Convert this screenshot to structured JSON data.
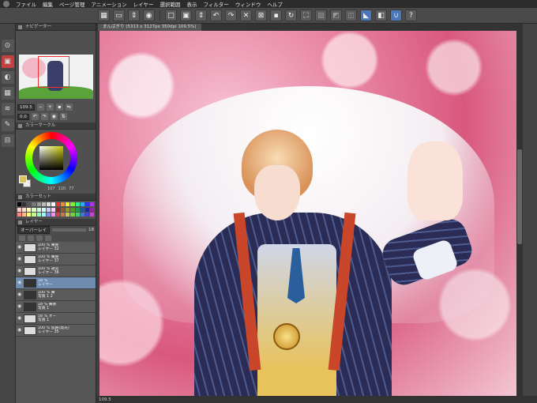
{
  "menu": [
    "ファイル",
    "編集",
    "ページ管理",
    "アニメーション",
    "レイヤー",
    "選択範囲",
    "表示",
    "フィルター",
    "ウィンドウ",
    "ヘルプ"
  ],
  "document_tab": "まんばぎり (5313 x 3127px 350dpi 109.5%)",
  "panels": {
    "navigator_title": "ナビゲーター",
    "navigator_zoom": "109.5",
    "navigator_angle": "0.0",
    "color_circle_title": "カラーサークル",
    "hsv": {
      "h": "107",
      "s": "110",
      "v": "77"
    },
    "color_set_title": "カラーセット",
    "layer_title": "レイヤー",
    "blend_mode": "オーバーレイ",
    "opacity": "18"
  },
  "layers": [
    {
      "line1": "100 % 乗算",
      "line2": "レイヤー 32",
      "selected": false,
      "dark": false
    },
    {
      "line1": "100 % 乗算",
      "line2": "レイヤー 37",
      "selected": false,
      "dark": false
    },
    {
      "line1": "100 % 通常",
      "line2": "レイヤー 36",
      "selected": false,
      "dark": false
    },
    {
      "line1": "18 %",
      "line2": "レイヤー",
      "selected": true,
      "dark": true
    },
    {
      "line1": "100 % 乗",
      "line2": "写真 1 2",
      "selected": false,
      "dark": true
    },
    {
      "line1": "18 % 乗算",
      "line2": "写真 1",
      "selected": false,
      "dark": true
    },
    {
      "line1": "58 % オー",
      "line2": "写真 1",
      "selected": false,
      "dark": false
    },
    {
      "line1": "100 % 加算(発光)",
      "line2": "レイヤー 35",
      "selected": false,
      "dark": false
    }
  ],
  "status": {
    "zoom": "109.5"
  },
  "colors": {
    "accent": "#4b77b8",
    "selected_layer": "#6e8bb0"
  }
}
